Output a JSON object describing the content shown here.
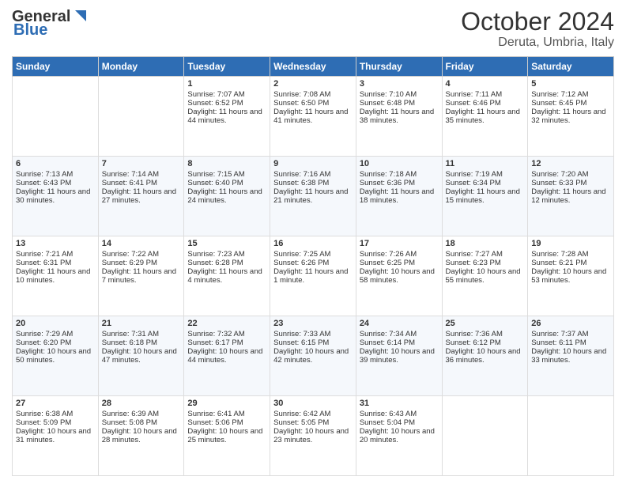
{
  "header": {
    "logo_line1": "General",
    "logo_line2": "Blue",
    "month": "October 2024",
    "location": "Deruta, Umbria, Italy"
  },
  "weekdays": [
    "Sunday",
    "Monday",
    "Tuesday",
    "Wednesday",
    "Thursday",
    "Friday",
    "Saturday"
  ],
  "weeks": [
    [
      {
        "day": "",
        "sunrise": "",
        "sunset": "",
        "daylight": ""
      },
      {
        "day": "",
        "sunrise": "",
        "sunset": "",
        "daylight": ""
      },
      {
        "day": "1",
        "sunrise": "Sunrise: 7:07 AM",
        "sunset": "Sunset: 6:52 PM",
        "daylight": "Daylight: 11 hours and 44 minutes."
      },
      {
        "day": "2",
        "sunrise": "Sunrise: 7:08 AM",
        "sunset": "Sunset: 6:50 PM",
        "daylight": "Daylight: 11 hours and 41 minutes."
      },
      {
        "day": "3",
        "sunrise": "Sunrise: 7:10 AM",
        "sunset": "Sunset: 6:48 PM",
        "daylight": "Daylight: 11 hours and 38 minutes."
      },
      {
        "day": "4",
        "sunrise": "Sunrise: 7:11 AM",
        "sunset": "Sunset: 6:46 PM",
        "daylight": "Daylight: 11 hours and 35 minutes."
      },
      {
        "day": "5",
        "sunrise": "Sunrise: 7:12 AM",
        "sunset": "Sunset: 6:45 PM",
        "daylight": "Daylight: 11 hours and 32 minutes."
      }
    ],
    [
      {
        "day": "6",
        "sunrise": "Sunrise: 7:13 AM",
        "sunset": "Sunset: 6:43 PM",
        "daylight": "Daylight: 11 hours and 30 minutes."
      },
      {
        "day": "7",
        "sunrise": "Sunrise: 7:14 AM",
        "sunset": "Sunset: 6:41 PM",
        "daylight": "Daylight: 11 hours and 27 minutes."
      },
      {
        "day": "8",
        "sunrise": "Sunrise: 7:15 AM",
        "sunset": "Sunset: 6:40 PM",
        "daylight": "Daylight: 11 hours and 24 minutes."
      },
      {
        "day": "9",
        "sunrise": "Sunrise: 7:16 AM",
        "sunset": "Sunset: 6:38 PM",
        "daylight": "Daylight: 11 hours and 21 minutes."
      },
      {
        "day": "10",
        "sunrise": "Sunrise: 7:18 AM",
        "sunset": "Sunset: 6:36 PM",
        "daylight": "Daylight: 11 hours and 18 minutes."
      },
      {
        "day": "11",
        "sunrise": "Sunrise: 7:19 AM",
        "sunset": "Sunset: 6:34 PM",
        "daylight": "Daylight: 11 hours and 15 minutes."
      },
      {
        "day": "12",
        "sunrise": "Sunrise: 7:20 AM",
        "sunset": "Sunset: 6:33 PM",
        "daylight": "Daylight: 11 hours and 12 minutes."
      }
    ],
    [
      {
        "day": "13",
        "sunrise": "Sunrise: 7:21 AM",
        "sunset": "Sunset: 6:31 PM",
        "daylight": "Daylight: 11 hours and 10 minutes."
      },
      {
        "day": "14",
        "sunrise": "Sunrise: 7:22 AM",
        "sunset": "Sunset: 6:29 PM",
        "daylight": "Daylight: 11 hours and 7 minutes."
      },
      {
        "day": "15",
        "sunrise": "Sunrise: 7:23 AM",
        "sunset": "Sunset: 6:28 PM",
        "daylight": "Daylight: 11 hours and 4 minutes."
      },
      {
        "day": "16",
        "sunrise": "Sunrise: 7:25 AM",
        "sunset": "Sunset: 6:26 PM",
        "daylight": "Daylight: 11 hours and 1 minute."
      },
      {
        "day": "17",
        "sunrise": "Sunrise: 7:26 AM",
        "sunset": "Sunset: 6:25 PM",
        "daylight": "Daylight: 10 hours and 58 minutes."
      },
      {
        "day": "18",
        "sunrise": "Sunrise: 7:27 AM",
        "sunset": "Sunset: 6:23 PM",
        "daylight": "Daylight: 10 hours and 55 minutes."
      },
      {
        "day": "19",
        "sunrise": "Sunrise: 7:28 AM",
        "sunset": "Sunset: 6:21 PM",
        "daylight": "Daylight: 10 hours and 53 minutes."
      }
    ],
    [
      {
        "day": "20",
        "sunrise": "Sunrise: 7:29 AM",
        "sunset": "Sunset: 6:20 PM",
        "daylight": "Daylight: 10 hours and 50 minutes."
      },
      {
        "day": "21",
        "sunrise": "Sunrise: 7:31 AM",
        "sunset": "Sunset: 6:18 PM",
        "daylight": "Daylight: 10 hours and 47 minutes."
      },
      {
        "day": "22",
        "sunrise": "Sunrise: 7:32 AM",
        "sunset": "Sunset: 6:17 PM",
        "daylight": "Daylight: 10 hours and 44 minutes."
      },
      {
        "day": "23",
        "sunrise": "Sunrise: 7:33 AM",
        "sunset": "Sunset: 6:15 PM",
        "daylight": "Daylight: 10 hours and 42 minutes."
      },
      {
        "day": "24",
        "sunrise": "Sunrise: 7:34 AM",
        "sunset": "Sunset: 6:14 PM",
        "daylight": "Daylight: 10 hours and 39 minutes."
      },
      {
        "day": "25",
        "sunrise": "Sunrise: 7:36 AM",
        "sunset": "Sunset: 6:12 PM",
        "daylight": "Daylight: 10 hours and 36 minutes."
      },
      {
        "day": "26",
        "sunrise": "Sunrise: 7:37 AM",
        "sunset": "Sunset: 6:11 PM",
        "daylight": "Daylight: 10 hours and 33 minutes."
      }
    ],
    [
      {
        "day": "27",
        "sunrise": "Sunrise: 6:38 AM",
        "sunset": "Sunset: 5:09 PM",
        "daylight": "Daylight: 10 hours and 31 minutes."
      },
      {
        "day": "28",
        "sunrise": "Sunrise: 6:39 AM",
        "sunset": "Sunset: 5:08 PM",
        "daylight": "Daylight: 10 hours and 28 minutes."
      },
      {
        "day": "29",
        "sunrise": "Sunrise: 6:41 AM",
        "sunset": "Sunset: 5:06 PM",
        "daylight": "Daylight: 10 hours and 25 minutes."
      },
      {
        "day": "30",
        "sunrise": "Sunrise: 6:42 AM",
        "sunset": "Sunset: 5:05 PM",
        "daylight": "Daylight: 10 hours and 23 minutes."
      },
      {
        "day": "31",
        "sunrise": "Sunrise: 6:43 AM",
        "sunset": "Sunset: 5:04 PM",
        "daylight": "Daylight: 10 hours and 20 minutes."
      },
      {
        "day": "",
        "sunrise": "",
        "sunset": "",
        "daylight": ""
      },
      {
        "day": "",
        "sunrise": "",
        "sunset": "",
        "daylight": ""
      }
    ]
  ]
}
